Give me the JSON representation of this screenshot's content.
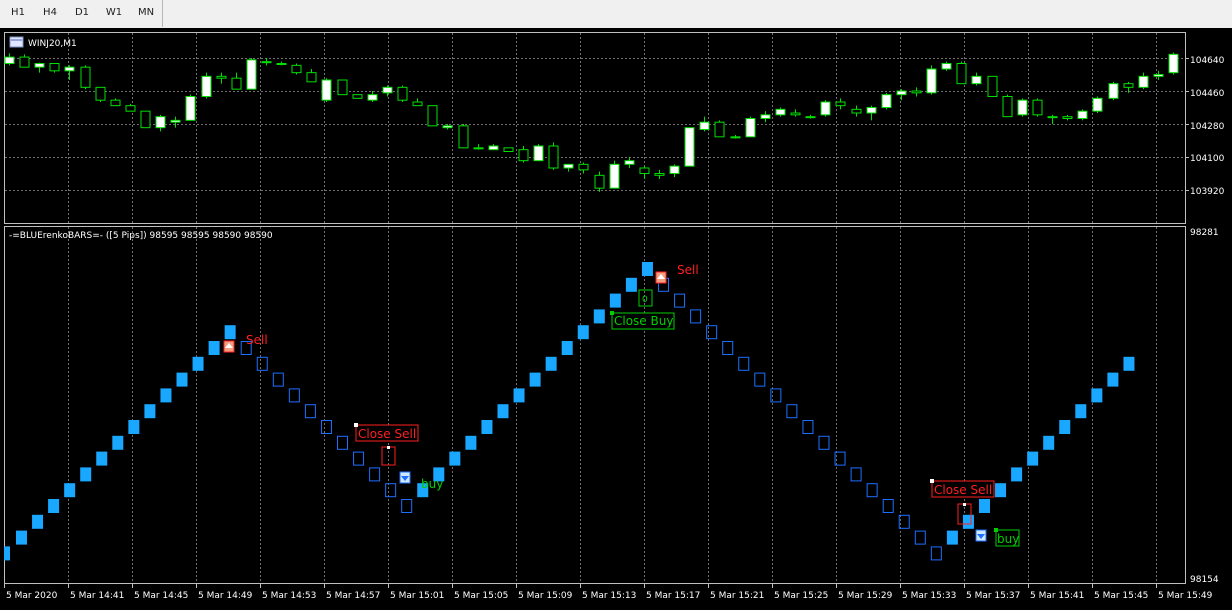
{
  "toolbar": {
    "timeframes": [
      "H1",
      "H4",
      "D1",
      "W1",
      "MN"
    ]
  },
  "price_window": {
    "title": "WINJ20,M1",
    "price_labels": [
      "104640",
      "104460",
      "104280",
      "104100",
      "103920"
    ]
  },
  "indicator_window": {
    "title": "-=BLUErenkoBARS=- ([5 Pips]) 98595 98595 98590 98590",
    "scale_top": "98281",
    "scale_bottom": "98154"
  },
  "time_axis": {
    "labels": [
      "5 Mar 2020",
      "5 Mar 14:41",
      "5 Mar 14:45",
      "5 Mar 14:49",
      "5 Mar 14:53",
      "5 Mar 14:57",
      "5 Mar 15:01",
      "5 Mar 15:05",
      "5 Mar 15:09",
      "5 Mar 15:13",
      "5 Mar 15:17",
      "5 Mar 15:21",
      "5 Mar 15:25",
      "5 Mar 15:29",
      "5 Mar 15:33",
      "5 Mar 15:37",
      "5 Mar 15:41",
      "5 Mar 15:45",
      "5 Mar 15:49"
    ]
  },
  "signals": {
    "sell_1": "Sell",
    "sell_2": "Sell",
    "close_sell_1": "Close Sell",
    "close_sell_2": "Close Sell",
    "close_buy": "Close Buy",
    "buy_1": "buy",
    "buy_2": "buy"
  },
  "colors": {
    "bull_candle": "#ffffff",
    "bear_candle": "#000000",
    "candle_outline": "#00e000",
    "renko_up": "#1aa7ff",
    "renko_down_outline": "#1e6fff",
    "sell_text": "#ff2020",
    "buy_text": "#00d000",
    "grid": "#707070"
  },
  "chart_data": {
    "type": "candlestick",
    "symbol": "WINJ20",
    "timeframe": "M1",
    "y_ticks": [
      104640,
      104460,
      104280,
      104100,
      103920
    ],
    "candles": [
      {
        "o": 104610,
        "h": 104665,
        "l": 104600,
        "c": 104645
      },
      {
        "o": 104645,
        "h": 104660,
        "l": 104590,
        "c": 104590
      },
      {
        "o": 104590,
        "h": 104615,
        "l": 104560,
        "c": 104610
      },
      {
        "o": 104610,
        "h": 104610,
        "l": 104560,
        "c": 104570
      },
      {
        "o": 104570,
        "h": 104600,
        "l": 104520,
        "c": 104590
      },
      {
        "o": 104590,
        "h": 104600,
        "l": 104470,
        "c": 104480
      },
      {
        "o": 104480,
        "h": 104480,
        "l": 104400,
        "c": 104410
      },
      {
        "o": 104410,
        "h": 104420,
        "l": 104380,
        "c": 104380
      },
      {
        "o": 104380,
        "h": 104390,
        "l": 104350,
        "c": 104350
      },
      {
        "o": 104350,
        "h": 104350,
        "l": 104260,
        "c": 104260
      },
      {
        "o": 104260,
        "h": 104330,
        "l": 104240,
        "c": 104320
      },
      {
        "o": 104290,
        "h": 104320,
        "l": 104260,
        "c": 104300
      },
      {
        "o": 104300,
        "h": 104440,
        "l": 104300,
        "c": 104430
      },
      {
        "o": 104430,
        "h": 104560,
        "l": 104420,
        "c": 104540
      },
      {
        "o": 104540,
        "h": 104560,
        "l": 104500,
        "c": 104530
      },
      {
        "o": 104530,
        "h": 104560,
        "l": 104470,
        "c": 104470
      },
      {
        "o": 104470,
        "h": 104640,
        "l": 104470,
        "c": 104630
      },
      {
        "o": 104620,
        "h": 104640,
        "l": 104600,
        "c": 104620
      },
      {
        "o": 104610,
        "h": 104620,
        "l": 104600,
        "c": 104610
      },
      {
        "o": 104600,
        "h": 104610,
        "l": 104550,
        "c": 104560
      },
      {
        "o": 104560,
        "h": 104580,
        "l": 104510,
        "c": 104510
      },
      {
        "o": 104410,
        "h": 104530,
        "l": 104400,
        "c": 104520
      },
      {
        "o": 104520,
        "h": 104520,
        "l": 104440,
        "c": 104440
      },
      {
        "o": 104440,
        "h": 104440,
        "l": 104420,
        "c": 104420
      },
      {
        "o": 104410,
        "h": 104460,
        "l": 104400,
        "c": 104440
      },
      {
        "o": 104450,
        "h": 104490,
        "l": 104430,
        "c": 104480
      },
      {
        "o": 104480,
        "h": 104490,
        "l": 104400,
        "c": 104410
      },
      {
        "o": 104400,
        "h": 104420,
        "l": 104380,
        "c": 104380
      },
      {
        "o": 104380,
        "h": 104380,
        "l": 104270,
        "c": 104270
      },
      {
        "o": 104260,
        "h": 104280,
        "l": 104250,
        "c": 104270
      },
      {
        "o": 104270,
        "h": 104280,
        "l": 104150,
        "c": 104150
      },
      {
        "o": 104150,
        "h": 104170,
        "l": 104140,
        "c": 104150
      },
      {
        "o": 104140,
        "h": 104170,
        "l": 104140,
        "c": 104160
      },
      {
        "o": 104150,
        "h": 104150,
        "l": 104130,
        "c": 104130
      },
      {
        "o": 104140,
        "h": 104160,
        "l": 104070,
        "c": 104080
      },
      {
        "o": 104080,
        "h": 104170,
        "l": 104080,
        "c": 104160
      },
      {
        "o": 104160,
        "h": 104180,
        "l": 104030,
        "c": 104040
      },
      {
        "o": 104040,
        "h": 104060,
        "l": 104020,
        "c": 104060
      },
      {
        "o": 104060,
        "h": 104070,
        "l": 104010,
        "c": 104030
      },
      {
        "o": 104000,
        "h": 104020,
        "l": 103910,
        "c": 103930
      },
      {
        "o": 103930,
        "h": 104080,
        "l": 103930,
        "c": 104060
      },
      {
        "o": 104060,
        "h": 104100,
        "l": 104040,
        "c": 104080
      },
      {
        "o": 104040,
        "h": 104050,
        "l": 103980,
        "c": 104010
      },
      {
        "o": 104010,
        "h": 104030,
        "l": 103980,
        "c": 104000
      },
      {
        "o": 104010,
        "h": 104060,
        "l": 103990,
        "c": 104050
      },
      {
        "o": 104050,
        "h": 104260,
        "l": 104050,
        "c": 104260
      },
      {
        "o": 104250,
        "h": 104320,
        "l": 104240,
        "c": 104290
      },
      {
        "o": 104290,
        "h": 104300,
        "l": 104210,
        "c": 104210
      },
      {
        "o": 104210,
        "h": 104220,
        "l": 104200,
        "c": 104210
      },
      {
        "o": 104210,
        "h": 104320,
        "l": 104210,
        "c": 104310
      },
      {
        "o": 104310,
        "h": 104350,
        "l": 104290,
        "c": 104330
      },
      {
        "o": 104330,
        "h": 104370,
        "l": 104320,
        "c": 104360
      },
      {
        "o": 104340,
        "h": 104360,
        "l": 104320,
        "c": 104330
      },
      {
        "o": 104320,
        "h": 104330,
        "l": 104310,
        "c": 104320
      },
      {
        "o": 104330,
        "h": 104410,
        "l": 104320,
        "c": 104400
      },
      {
        "o": 104400,
        "h": 104420,
        "l": 104360,
        "c": 104380
      },
      {
        "o": 104360,
        "h": 104380,
        "l": 104320,
        "c": 104340
      },
      {
        "o": 104340,
        "h": 104380,
        "l": 104300,
        "c": 104370
      },
      {
        "o": 104370,
        "h": 104450,
        "l": 104360,
        "c": 104440
      },
      {
        "o": 104440,
        "h": 104470,
        "l": 104410,
        "c": 104460
      },
      {
        "o": 104460,
        "h": 104480,
        "l": 104430,
        "c": 104450
      },
      {
        "o": 104450,
        "h": 104600,
        "l": 104440,
        "c": 104580
      },
      {
        "o": 104580,
        "h": 104620,
        "l": 104570,
        "c": 104610
      },
      {
        "o": 104610,
        "h": 104620,
        "l": 104500,
        "c": 104500
      },
      {
        "o": 104500,
        "h": 104560,
        "l": 104490,
        "c": 104540
      },
      {
        "o": 104540,
        "h": 104540,
        "l": 104430,
        "c": 104430
      },
      {
        "o": 104430,
        "h": 104440,
        "l": 104320,
        "c": 104320
      },
      {
        "o": 104330,
        "h": 104420,
        "l": 104320,
        "c": 104410
      },
      {
        "o": 104410,
        "h": 104420,
        "l": 104320,
        "c": 104330
      },
      {
        "o": 104320,
        "h": 104330,
        "l": 104280,
        "c": 104320
      },
      {
        "o": 104320,
        "h": 104330,
        "l": 104300,
        "c": 104310
      },
      {
        "o": 104310,
        "h": 104360,
        "l": 104300,
        "c": 104350
      },
      {
        "o": 104350,
        "h": 104430,
        "l": 104340,
        "c": 104420
      },
      {
        "o": 104420,
        "h": 104510,
        "l": 104410,
        "c": 104500
      },
      {
        "o": 104500,
        "h": 104510,
        "l": 104450,
        "c": 104480
      },
      {
        "o": 104480,
        "h": 104560,
        "l": 104470,
        "c": 104540
      },
      {
        "o": 104540,
        "h": 104570,
        "l": 104520,
        "c": 104550
      },
      {
        "o": 104560,
        "h": 104670,
        "l": 104550,
        "c": 104660
      }
    ]
  },
  "renko_data": {
    "type": "renko",
    "brick_size": "5 Pips",
    "y_range": [
      98154,
      98281
    ],
    "bricks": [
      {
        "d": "up",
        "v": 98160
      },
      {
        "d": "up",
        "v": 98165
      },
      {
        "d": "up",
        "v": 98170
      },
      {
        "d": "up",
        "v": 98175
      },
      {
        "d": "up",
        "v": 98180
      },
      {
        "d": "up",
        "v": 98185
      },
      {
        "d": "up",
        "v": 98190
      },
      {
        "d": "up",
        "v": 98195
      },
      {
        "d": "up",
        "v": 98200
      },
      {
        "d": "up",
        "v": 98205
      },
      {
        "d": "up",
        "v": 98210
      },
      {
        "d": "up",
        "v": 98215
      },
      {
        "d": "up",
        "v": 98220
      },
      {
        "d": "up",
        "v": 98225
      },
      {
        "d": "down",
        "v": 98220
      },
      {
        "d": "down",
        "v": 98215
      },
      {
        "d": "down",
        "v": 98210
      },
      {
        "d": "down",
        "v": 98205
      },
      {
        "d": "down",
        "v": 98200
      },
      {
        "d": "down",
        "v": 98195
      },
      {
        "d": "down",
        "v": 98190
      },
      {
        "d": "down",
        "v": 98185
      },
      {
        "d": "down",
        "v": 98180
      },
      {
        "d": "down",
        "v": 98175
      },
      {
        "d": "down",
        "v": 98170
      },
      {
        "d": "up",
        "v": 98175
      },
      {
        "d": "up",
        "v": 98180
      },
      {
        "d": "up",
        "v": 98185
      },
      {
        "d": "up",
        "v": 98190
      },
      {
        "d": "up",
        "v": 98195
      },
      {
        "d": "up",
        "v": 98200
      },
      {
        "d": "up",
        "v": 98205
      },
      {
        "d": "up",
        "v": 98210
      },
      {
        "d": "up",
        "v": 98215
      },
      {
        "d": "up",
        "v": 98220
      },
      {
        "d": "up",
        "v": 98225
      },
      {
        "d": "up",
        "v": 98230
      },
      {
        "d": "up",
        "v": 98235
      },
      {
        "d": "up",
        "v": 98240
      },
      {
        "d": "up",
        "v": 98245
      },
      {
        "d": "down",
        "v": 98240
      },
      {
        "d": "down",
        "v": 98235
      },
      {
        "d": "down",
        "v": 98230
      },
      {
        "d": "down",
        "v": 98225
      },
      {
        "d": "down",
        "v": 98220
      },
      {
        "d": "down",
        "v": 98215
      },
      {
        "d": "down",
        "v": 98210
      },
      {
        "d": "down",
        "v": 98205
      },
      {
        "d": "down",
        "v": 98200
      },
      {
        "d": "down",
        "v": 98195
      },
      {
        "d": "down",
        "v": 98190
      },
      {
        "d": "down",
        "v": 98185
      },
      {
        "d": "down",
        "v": 98180
      },
      {
        "d": "down",
        "v": 98175
      },
      {
        "d": "down",
        "v": 98170
      },
      {
        "d": "down",
        "v": 98165
      },
      {
        "d": "down",
        "v": 98160
      },
      {
        "d": "down",
        "v": 98155
      },
      {
        "d": "up",
        "v": 98160
      },
      {
        "d": "up",
        "v": 98165
      },
      {
        "d": "up",
        "v": 98170
      },
      {
        "d": "up",
        "v": 98175
      },
      {
        "d": "up",
        "v": 98180
      },
      {
        "d": "up",
        "v": 98185
      },
      {
        "d": "up",
        "v": 98190
      },
      {
        "d": "up",
        "v": 98195
      },
      {
        "d": "up",
        "v": 98200
      },
      {
        "d": "up",
        "v": 98205
      },
      {
        "d": "up",
        "v": 98210
      },
      {
        "d": "up",
        "v": 98215
      }
    ]
  }
}
